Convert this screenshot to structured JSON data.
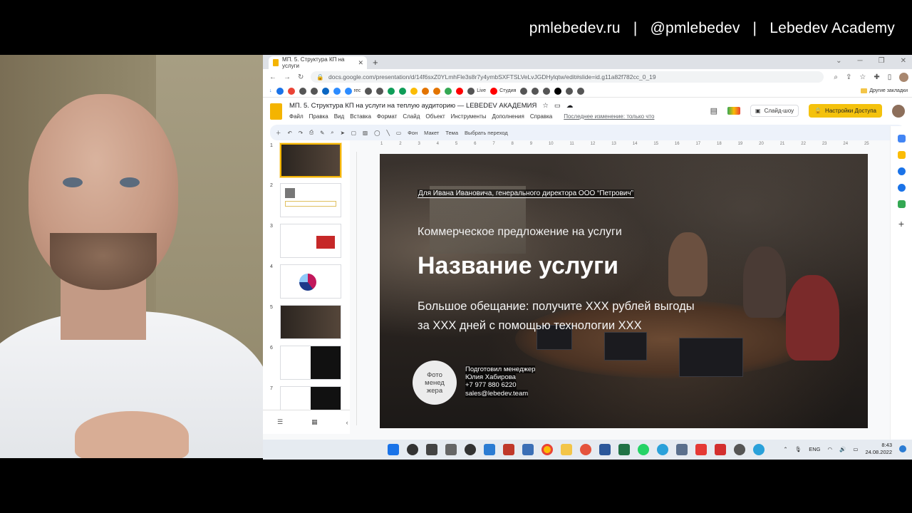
{
  "banner": {
    "site": "pmlebedev.ru",
    "sep1": "|",
    "handle": "@pmlebedev",
    "sep2": "|",
    "academy": "Lebedev Academy"
  },
  "browser": {
    "tab_title": "МП. 5. Структура КП на услуги",
    "url": "docs.google.com/presentation/d/14f6sxZ0YLmhFle3s8r7y4ymbSXFTSLVeLvJGDHylqtw/edit#slide=id.g11a82f782cc_0_19",
    "bookmarks": {
      "rec": "rec",
      "live": "Live",
      "studio": "Студия",
      "other": "Другие закладки"
    }
  },
  "slides_app": {
    "title": "МП. 5. Структура КП на услуги на теплую аудиторию — LEBEDEV АКАДЕМИЯ",
    "menus": [
      "Файл",
      "Правка",
      "Вид",
      "Вставка",
      "Формат",
      "Слайд",
      "Объект",
      "Инструменты",
      "Дополнения",
      "Справка"
    ],
    "last_edit": "Последнее изменение: только что",
    "slideshow_label": "Слайд-шоу",
    "share_label": "Настройки Доступа",
    "toolbar": {
      "bg": "Фон",
      "layout": "Макет",
      "theme": "Тема",
      "transition": "Выбрать переход"
    },
    "slide_numbers": [
      "1",
      "2",
      "3",
      "4",
      "5",
      "6",
      "7"
    ],
    "ruler": [
      "1",
      "2",
      "3",
      "4",
      "5",
      "6",
      "7",
      "8",
      "9",
      "10",
      "11",
      "12",
      "13",
      "14",
      "15",
      "16",
      "17",
      "18",
      "19",
      "20",
      "21",
      "22",
      "23",
      "24",
      "25"
    ]
  },
  "slide": {
    "recipient": "Для Ивана Ивановича, генерального директора ООО “Петрович”",
    "subtitle": "Коммерческое предложение на услуги",
    "title": "Название услуги",
    "promise": "Большое обещание: получите XXX рублей выгоды за XXX дней с помощью технологии XXX",
    "photo_placeholder": "Фото менед жера",
    "manager": {
      "prepared": "Подготовил менеджер",
      "name": "Юлия Хабирова",
      "phone": "+7 977 880 6220",
      "email": "sales@lebedev.team"
    }
  },
  "taskbar": {
    "lang": "ENG",
    "time": "8:43",
    "date": "24.08.2022"
  }
}
